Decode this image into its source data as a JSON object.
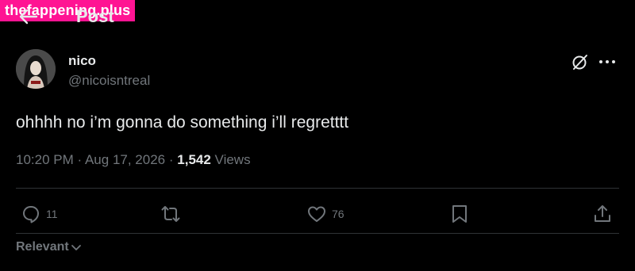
{
  "watermark": "thefappening.plus",
  "header": {
    "title": "Post"
  },
  "author": {
    "name": "nico",
    "handle": "@nicoisntreal"
  },
  "post": {
    "text": "ohhhh no i’m gonna do something i’ll regretttt",
    "time": "10:20 PM",
    "separator1": "·",
    "date": "Aug 17, 2026",
    "separator2": "·",
    "views_count": "1,542",
    "views_label": "Views"
  },
  "actions": {
    "reply_count": "11",
    "repost_count": "",
    "like_count": "76"
  },
  "replies_sort": {
    "label": "Relevant"
  },
  "colors": {
    "background": "#000000",
    "text": "#e7e9ea",
    "muted": "#71767b",
    "divider": "#2f3336",
    "watermark": "#ff1493"
  }
}
